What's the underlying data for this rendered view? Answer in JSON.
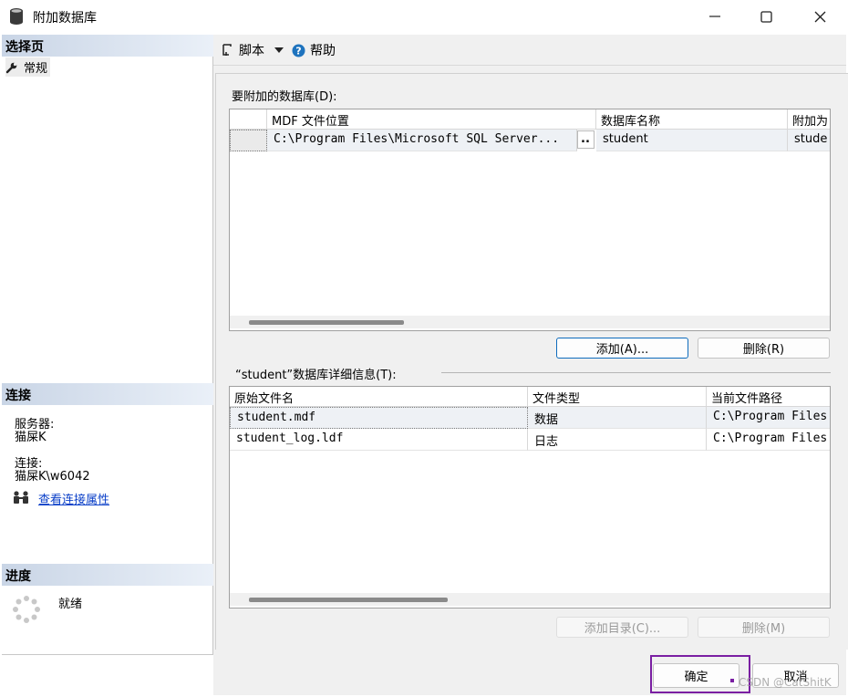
{
  "window": {
    "title": "附加数据库",
    "minimize_icon": "minimize-icon",
    "maximize_icon": "maximize-icon",
    "close_icon": "close-icon"
  },
  "left": {
    "select_page_header": "选择页",
    "pages": [
      {
        "label": "常规",
        "icon": "wrench-icon"
      }
    ],
    "connection_header": "连接",
    "server_label": "服务器:",
    "server_value": "猫屎K",
    "connection_label": "连接:",
    "connection_value": "猫屎K\\w6042",
    "view_props_link": "查看连接属性",
    "progress_header": "进度",
    "progress_status": "就绪"
  },
  "toolbar": {
    "script_label": "脚本",
    "help_label": "帮助"
  },
  "attach": {
    "section_label": "要附加的数据库(D):",
    "columns": [
      "MDF 文件位置",
      "数据库名称",
      "附加为"
    ],
    "rows": [
      {
        "mdf": "C:\\Program Files\\Microsoft SQL Server...",
        "browse": "..",
        "db_name": "student",
        "attach_as": "stude"
      }
    ],
    "add_button": "添加(A)...",
    "remove_button": "删除(R)"
  },
  "details": {
    "section_label": "“student”数据库详细信息(T):",
    "columns": [
      "原始文件名",
      "文件类型",
      "当前文件路径"
    ],
    "rows": [
      {
        "file": "student.mdf",
        "type": "数据",
        "path": "C:\\Program Files"
      },
      {
        "file": "student_log.ldf",
        "type": "日志",
        "path": "C:\\Program Files"
      }
    ],
    "add_catalog_button": "添加目录(C)...",
    "remove_button": "删除(M)"
  },
  "footer": {
    "ok_button": "确定",
    "cancel_button": "取消",
    "watermark": "CSDN @CatShitK"
  },
  "colors": {
    "highlight_box": "#7a1fa2",
    "link": "#0a3fc8"
  }
}
